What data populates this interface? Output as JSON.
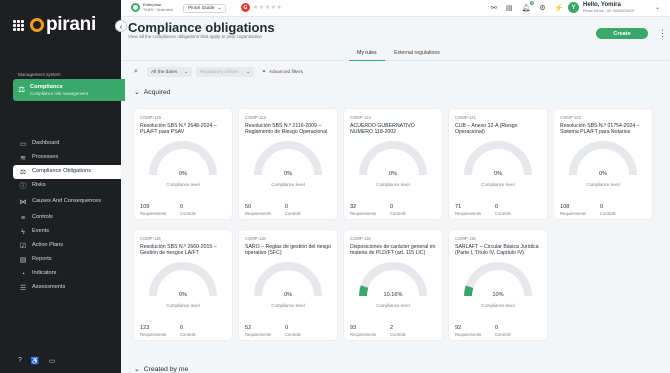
{
  "brand": {
    "name": "pirani"
  },
  "sidebar": {
    "section_label": "Management system",
    "active_system": {
      "title": "Compliance",
      "subtitle": "Compliance risk management"
    },
    "items": [
      {
        "label": "Dashboard",
        "icon": "monitor-icon"
      },
      {
        "label": "Processes",
        "icon": "layers-icon"
      },
      {
        "label": "Compliance Obligations",
        "icon": "scale-icon",
        "active": true
      },
      {
        "label": "Risks",
        "icon": "alert-icon"
      },
      {
        "label": "Causes And Consequences",
        "icon": "branch-icon"
      },
      {
        "label": "Controls",
        "icon": "sliders-icon"
      },
      {
        "label": "Events",
        "icon": "bolt-icon"
      },
      {
        "label": "Action Plans",
        "icon": "checklist-icon"
      },
      {
        "label": "Reports",
        "icon": "report-icon"
      },
      {
        "label": "Indicators",
        "icon": "gauge-icon"
      },
      {
        "label": "Assessments",
        "icon": "list-icon"
      }
    ]
  },
  "topbar": {
    "env_line1": "Enterprise",
    "env_line2": "TABS / Unlimited",
    "guide_label": "Pirani Guide",
    "rating_badge": "G",
    "stars": "★★★★★",
    "notification_count": "3",
    "user_name": "Hello, Yomira",
    "user_sub": "Pirani Demo / ID: 0000003419",
    "avatar_initial": "Y"
  },
  "page": {
    "title": "Compliance obligations",
    "subtitle": "View all the compliance obligations that apply to your organization",
    "create_label": "Create"
  },
  "tabs": [
    {
      "label": "My rules",
      "active": true
    },
    {
      "label": "External regulations",
      "active": false
    }
  ],
  "filters": {
    "dates_label": "All the dates",
    "regulatory_placeholder": "Regulatory influen",
    "advanced_label": "Advanced filters"
  },
  "sections": {
    "acquired": "Acquired",
    "created_by_me": "Created by me"
  },
  "card_labels": {
    "level": "Compliance level",
    "requirements": "Requirements",
    "controls": "Controls"
  },
  "colors": {
    "accent": "#3aa86b",
    "gauge_track": "#e6e8eb",
    "sidebar_bg": "#1e1f22"
  },
  "cards": [
    {
      "code": "COMP-126",
      "title": "Resolución SBS N.º 2648-2024 – PLA/FT para PSAV",
      "level": 0,
      "percent": "0%",
      "requirements": "109",
      "controls": "0"
    },
    {
      "code": "COMP-123",
      "title": "Resolución SBS N.º 2116-2009 – Reglamento de Riesgo Operacional",
      "level": 0,
      "percent": "0%",
      "requirements": "50",
      "controls": "0"
    },
    {
      "code": "COMP-122",
      "title": "ACUERDO GUBERNATIVO NUMERO 118-2002",
      "level": 0,
      "percent": "0%",
      "requirements": "32",
      "controls": "0"
    },
    {
      "code": "COMP-121",
      "title": "CUB – Anexo 12-A (Riesgo Operacional)",
      "level": 0,
      "percent": "0%",
      "requirements": "71",
      "controls": "0"
    },
    {
      "code": "COMP-120",
      "title": "Resolución SBS N.º 01754-2024 – Sistema PLA/FT para Notarios",
      "level": 0,
      "percent": "0%",
      "requirements": "108",
      "controls": "0"
    },
    {
      "code": "COMP-119",
      "title": "Resolución SBS N.º 2660-2015 – Gestión de riesgos LA/FT",
      "level": 0,
      "percent": "0%",
      "requirements": "123",
      "controls": "0"
    },
    {
      "code": "COMP-118",
      "title": "SARO – Reglas de gestión del riesgo operativo (SFC)",
      "level": 0,
      "percent": "0%",
      "requirements": "52",
      "controls": "0"
    },
    {
      "code": "COMP-116",
      "title": "Disposiciones de carácter general en materia de PLD/FT (art. 115 LIC)",
      "level": 10.16,
      "percent": "10.16%",
      "requirements": "93",
      "controls": "2"
    },
    {
      "code": "COMP-115",
      "title": "SARLAFT – Circular Básica Jurídica (Parte I, Título IV, Capítulo IV)",
      "level": 10,
      "percent": "10%",
      "requirements": "92",
      "controls": "0"
    }
  ]
}
